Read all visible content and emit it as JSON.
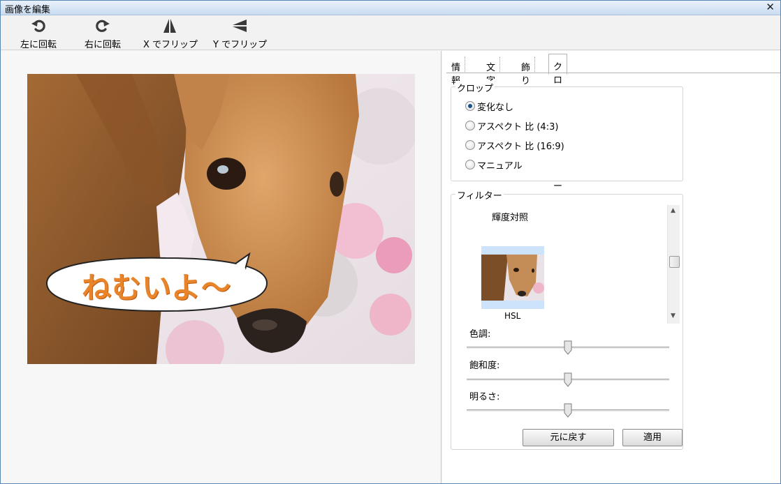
{
  "window": {
    "title": "画像を編集"
  },
  "toolbar": {
    "rotate_left": "左に回転",
    "rotate_right": "右に回転",
    "flip_x": "X でフリップ",
    "flip_y": "Y でフリップ"
  },
  "image": {
    "speech_bubble_text": "ねむいよ〜",
    "speech_bubble_color": "#e8852a"
  },
  "tabs": [
    {
      "label": "情報"
    },
    {
      "label": "文字"
    },
    {
      "label": "飾り"
    },
    {
      "label": "クロップ＆フィルター"
    }
  ],
  "active_tab": "クロップ＆フィルター",
  "crop": {
    "title": "クロップ",
    "options": [
      "変化なし",
      "アスペクト 比 (4:3)",
      "アスペクト 比 (16:9)",
      "マニュアル"
    ],
    "selected": "変化なし"
  },
  "filter": {
    "title": "フィルター",
    "heading": "輝度対照",
    "preset_label": "HSL",
    "sliders": {
      "hue": {
        "label": "色調:",
        "value": 0.5
      },
      "saturation": {
        "label": "飽和度:",
        "value": 0.5
      },
      "brightness": {
        "label": "明るさ:",
        "value": 0.5
      }
    },
    "reset_label": "元に戻す",
    "apply_label": "適用"
  },
  "colors": {
    "accent": "#1b4f8a",
    "selection": "#cde3fb"
  }
}
